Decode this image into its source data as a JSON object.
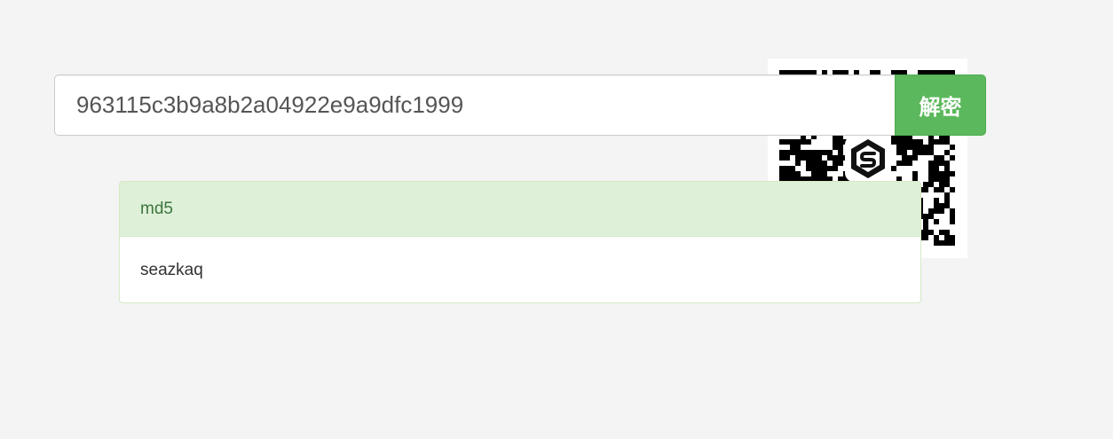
{
  "search": {
    "value": "963115c3b9a8b2a04922e9a9dfc1999",
    "button_label": "解密"
  },
  "result": {
    "heading": "md5",
    "plaintext": "seazkaq"
  },
  "qr": {
    "icon": "qr-code-icon",
    "logo_icon": "shield-logo-icon"
  },
  "colors": {
    "success": "#5cb85c",
    "panel_heading_bg": "#dff0d8",
    "panel_heading_text": "#3c763d",
    "panel_border": "#d6e9c6",
    "background": "#f4f4f4"
  }
}
